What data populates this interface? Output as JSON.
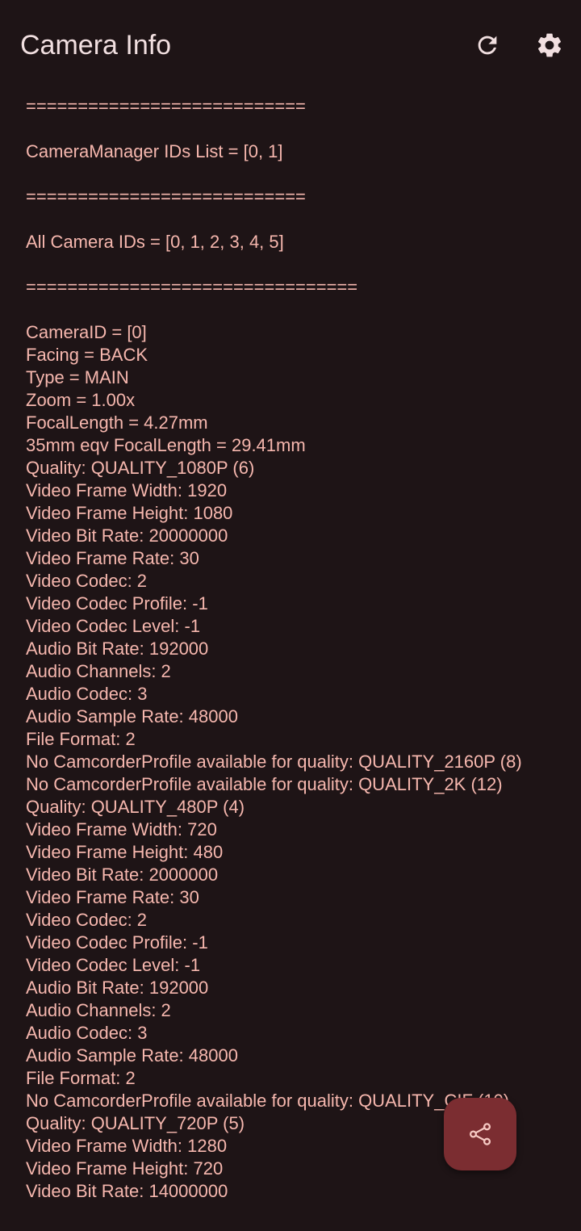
{
  "app_bar": {
    "title": "Camera Info",
    "refresh_icon": "refresh-icon",
    "settings_icon": "gear-icon"
  },
  "fab": {
    "icon": "share-icon"
  },
  "lines": [
    "===========================",
    "",
    "CameraManager IDs List = [0, 1]",
    "",
    "===========================",
    "",
    "All Camera IDs = [0, 1, 2, 3, 4, 5]",
    "",
    "================================",
    "",
    "CameraID = [0]",
    "Facing = BACK",
    "Type = MAIN",
    "Zoom = 1.00x",
    "FocalLength = 4.27mm",
    "35mm eqv FocalLength = 29.41mm",
    "Quality: QUALITY_1080P (6)",
    "Video Frame Width: 1920",
    "Video Frame Height: 1080",
    "Video Bit Rate: 20000000",
    "Video Frame Rate: 30",
    "Video Codec: 2",
    "Video Codec Profile: -1",
    "Video Codec Level: -1",
    "Audio Bit Rate: 192000",
    "Audio Channels: 2",
    "Audio Codec: 3",
    "Audio Sample Rate: 48000",
    "File Format: 2",
    "No CamcorderProfile available for quality: QUALITY_2160P (8)",
    "No CamcorderProfile available for quality: QUALITY_2K (12)",
    "Quality: QUALITY_480P (4)",
    "Video Frame Width: 720",
    "Video Frame Height: 480",
    "Video Bit Rate: 2000000",
    "Video Frame Rate: 30",
    "Video Codec: 2",
    "Video Codec Profile: -1",
    "Video Codec Level: -1",
    "Audio Bit Rate: 192000",
    "Audio Channels: 2",
    "Audio Codec: 3",
    "Audio Sample Rate: 48000",
    "File Format: 2",
    "No CamcorderProfile available for quality: QUALITY_CIF (10)",
    "Quality: QUALITY_720P (5)",
    "Video Frame Width: 1280",
    "Video Frame Height: 720",
    "Video Bit Rate: 14000000"
  ]
}
